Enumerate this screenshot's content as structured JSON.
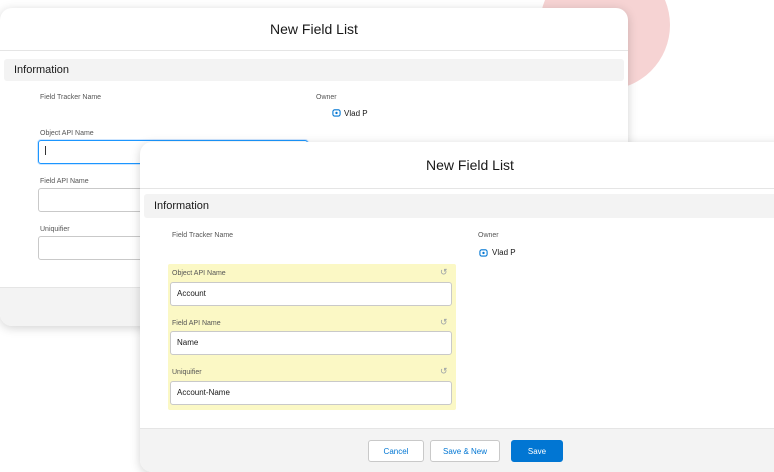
{
  "back_modal": {
    "title": "New Field List",
    "section": "Information",
    "field_tracker_label": "Field Tracker Name",
    "owner_label": "Owner",
    "owner_value": "Vlad P",
    "object_api_label": "Object API Name",
    "object_api_value": "",
    "field_api_label": "Field API Name",
    "field_api_value": "",
    "uniquifier_label": "Uniquifier",
    "uniquifier_value": ""
  },
  "front_modal": {
    "title": "New Field List",
    "section": "Information",
    "field_tracker_label": "Field Tracker Name",
    "owner_label": "Owner",
    "owner_value": "Vlad P",
    "object_api_label": "Object API Name",
    "object_api_value": "Account",
    "field_api_label": "Field API Name",
    "field_api_value": "Name",
    "uniquifier_label": "Uniquifier",
    "uniquifier_value": "Account-Name",
    "undo_icon": "undo-icon",
    "buttons": {
      "cancel": "Cancel",
      "save_new": "Save & New",
      "save": "Save"
    }
  },
  "colors": {
    "brand": "#0176d3",
    "highlight": "#fbf8c5",
    "decor_circle": "#f6d3d3"
  }
}
